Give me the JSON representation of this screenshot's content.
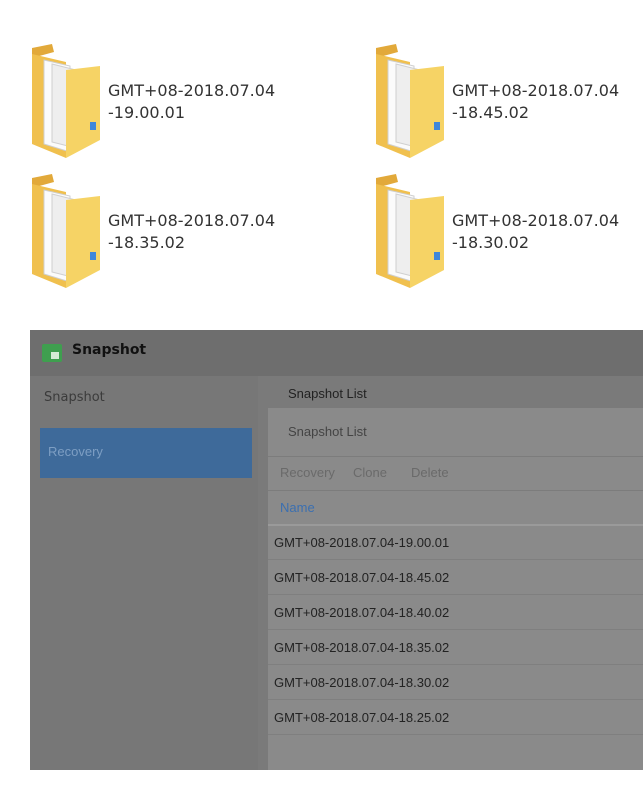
{
  "folders": [
    {
      "line1": "GMT+08-2018.07.04",
      "line2": "-19.00.01"
    },
    {
      "line1": "GMT+08-2018.07.04",
      "line2": "-18.45.02"
    },
    {
      "line1": "GMT+08-2018.07.04",
      "line2": "-18.35.02"
    },
    {
      "line1": "GMT+08-2018.07.04",
      "line2": "-18.30.02"
    }
  ],
  "app": {
    "title": "Snapshot",
    "icon": "snapshot-app-icon",
    "sidebar": {
      "header": "Snapshot",
      "items": [
        {
          "label": "Recovery"
        }
      ]
    },
    "main": {
      "header": "Snapshot List",
      "panel_title": "Snapshot List",
      "toolbar": {
        "recovery": "Recovery",
        "clone": "Clone",
        "delete": "Delete"
      },
      "column": "Name",
      "rows": [
        "GMT+08-2018.07.04-19.00.01",
        "GMT+08-2018.07.04-18.45.02",
        "GMT+08-2018.07.04-18.40.02",
        "GMT+08-2018.07.04-18.35.02",
        "GMT+08-2018.07.04-18.30.02",
        "GMT+08-2018.07.04-18.25.02"
      ]
    }
  },
  "colors": {
    "accent": "#3e6a9a",
    "link": "#3b6fb0",
    "folder": "#f2c94c"
  }
}
